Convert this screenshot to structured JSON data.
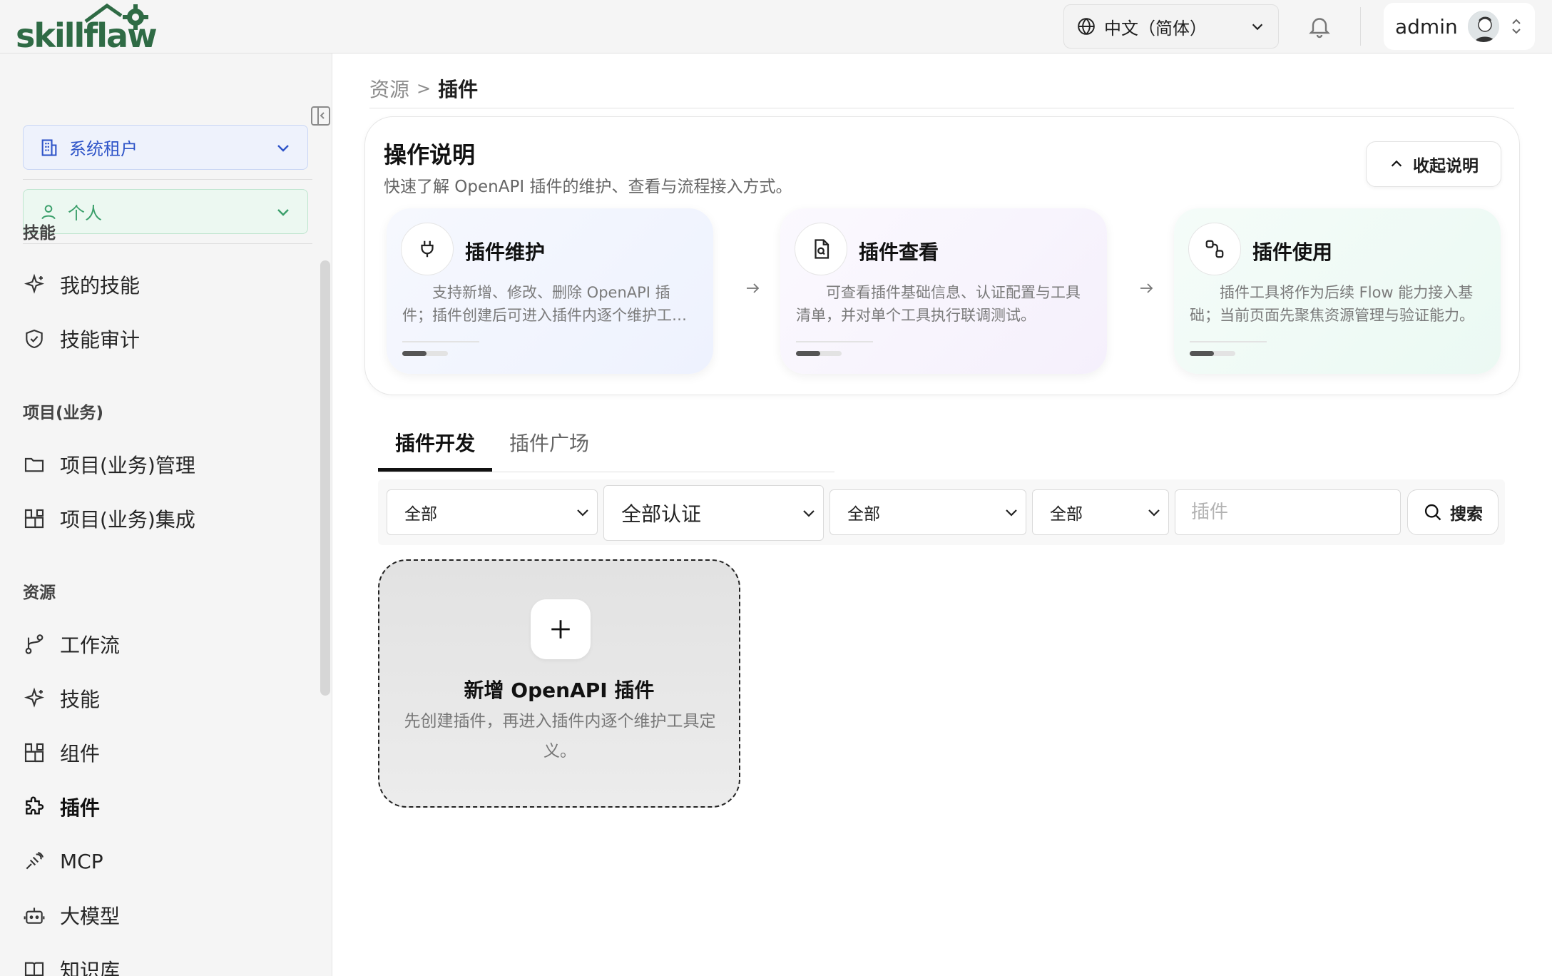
{
  "header": {
    "logo_text": "skillflaw",
    "language": "中文（简体）",
    "user_name": "admin"
  },
  "sidebar": {
    "tenant": "系统租户",
    "scope": "个人",
    "sections": [
      {
        "title": "技能",
        "items": [
          {
            "label": "我的技能",
            "icon": "sparkle-icon"
          },
          {
            "label": "技能审计",
            "icon": "shield-check-icon"
          }
        ]
      },
      {
        "title": "项目(业务)",
        "items": [
          {
            "label": "项目(业务)管理",
            "icon": "folder-icon"
          },
          {
            "label": "项目(业务)集成",
            "icon": "blocks-icon"
          }
        ]
      },
      {
        "title": "资源",
        "items": [
          {
            "label": "工作流",
            "icon": "workflow-icon"
          },
          {
            "label": "技能",
            "icon": "sparkle-icon"
          },
          {
            "label": "组件",
            "icon": "blocks-icon"
          },
          {
            "label": "插件",
            "icon": "puzzle-icon",
            "active": true
          },
          {
            "label": "MCP",
            "icon": "mcp-icon"
          },
          {
            "label": "大模型",
            "icon": "bot-icon"
          },
          {
            "label": "知识库",
            "icon": "book-icon"
          }
        ]
      }
    ]
  },
  "breadcrumb": {
    "parent": "资源",
    "separator": ">",
    "current": "插件"
  },
  "guide": {
    "title": "操作说明",
    "subtitle": "快速了解 OpenAPI 插件的维护、查看与流程接入方式。",
    "collapse_label": "收起说明",
    "steps": [
      {
        "title": "插件维护",
        "icon": "plug-icon",
        "desc": "支持新增、修改、删除 OpenAPI 插件；插件创建后可进入插件内逐个维护工具定义。"
      },
      {
        "title": "插件查看",
        "icon": "file-search-icon",
        "desc": "可查看插件基础信息、认证配置与工具清单，并对单个工具执行联调测试。"
      },
      {
        "title": "插件使用",
        "icon": "flow-link-icon",
        "desc": "插件工具将作为后续 Flow 能力接入基础；当前页面先聚焦资源管理与验证能力。"
      }
    ]
  },
  "tabs": {
    "items": [
      "插件开发",
      "插件广场"
    ],
    "active": 0
  },
  "filters": {
    "select1": "全部",
    "select2": "全部认证",
    "select3": "全部",
    "select4": "全部",
    "search_placeholder": "插件",
    "search_value": "",
    "search_label": "搜索"
  },
  "add_card": {
    "title": "新增 OpenAPI 插件",
    "desc": "先创建插件，再进入插件内逐个维护工具定义。"
  },
  "colors": {
    "tenant_accent": "#2e54c8",
    "personal_accent": "#3a9f6a",
    "brand_green": "#2f6b45"
  }
}
